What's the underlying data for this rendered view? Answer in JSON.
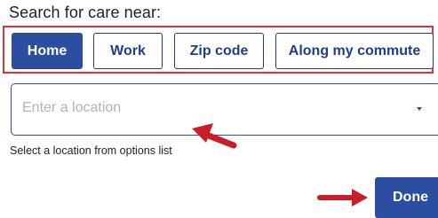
{
  "heading": "Search for care near:",
  "tabs": [
    {
      "label": "Home",
      "active": true
    },
    {
      "label": "Work",
      "active": false
    },
    {
      "label": "Zip code",
      "active": false
    },
    {
      "label": "Along my commute",
      "active": false
    }
  ],
  "location": {
    "placeholder": "Enter a location",
    "value": ""
  },
  "helper_text": "Select a location from options list",
  "done_label": "Done",
  "colors": {
    "primary": "#2b4ea1",
    "annotation_red": "#e0303a",
    "arrow_red": "#c81e28"
  },
  "icons": {
    "dropdown": "chevron-down-icon",
    "annotation_arrow": "arrow-icon"
  }
}
